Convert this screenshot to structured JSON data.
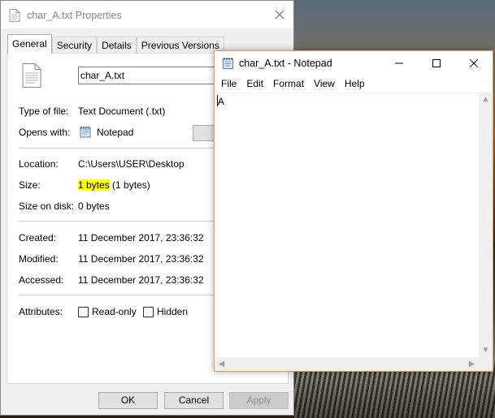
{
  "properties": {
    "title": "char_A.txt Properties",
    "tabs": [
      {
        "label": "General",
        "active": true
      },
      {
        "label": "Security"
      },
      {
        "label": "Details"
      },
      {
        "label": "Previous Versions"
      }
    ],
    "filename": "char_A.txt",
    "type_label": "Type of file:",
    "type_value": "Text Document (.txt)",
    "opens_label": "Opens with:",
    "opens_value": "Notepad",
    "location_label": "Location:",
    "location_value": "C:\\Users\\USER\\Desktop",
    "size_label": "Size:",
    "size_value_hl": "1 bytes",
    "size_value_rest": "(1 bytes)",
    "size_disk_label": "Size on disk:",
    "size_disk_value": "0 bytes",
    "created_label": "Created:",
    "created_value": "11 December 2017, 23:36:32",
    "modified_label": "Modified:",
    "modified_value": "11 December 2017, 23:36:32",
    "accessed_label": "Accessed:",
    "accessed_value": "11 December 2017, 23:36:32",
    "attributes_label": "Attributes:",
    "readonly_label": "Read-only",
    "hidden_label": "Hidden",
    "ok_label": "OK",
    "cancel_label": "Cancel",
    "apply_label": "Apply",
    "highlight_color": "#ffff00"
  },
  "notepad": {
    "title": "char_A.txt - Notepad",
    "menu": [
      "File",
      "Edit",
      "Format",
      "View",
      "Help"
    ],
    "content": "A",
    "border_color": "#d6a050"
  }
}
